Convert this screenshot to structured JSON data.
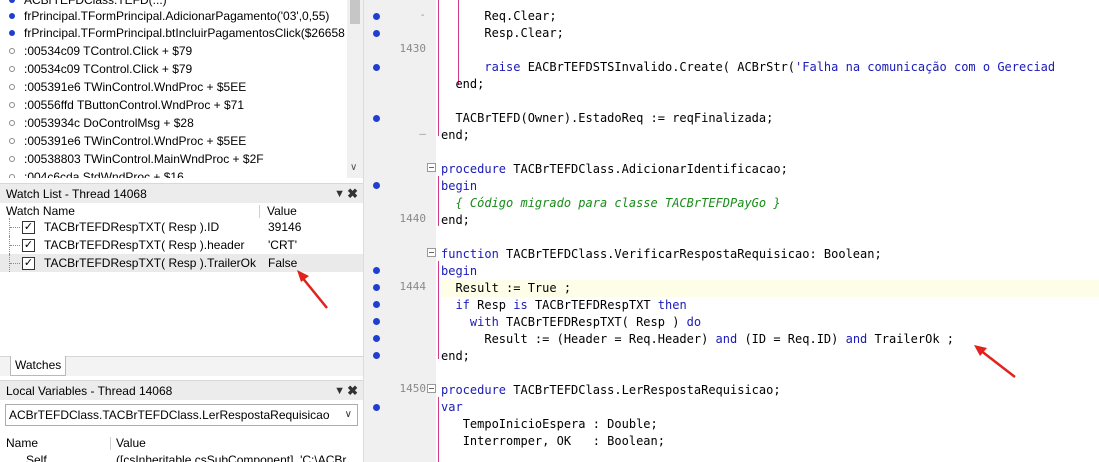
{
  "call_stack": {
    "rows": [
      {
        "dot": "blue",
        "text": "ACBrTEFDClass.TEFD(...)"
      },
      {
        "dot": "blue",
        "text": "frPrincipal.TFormPrincipal.AdicionarPagamento('03',0,55)"
      },
      {
        "dot": "blue",
        "text": "frPrincipal.TFormPrincipal.btIncluirPagamentosClick($26658"
      },
      {
        "dot": "grey",
        "text": ":00534c09 TControl.Click + $79"
      },
      {
        "dot": "grey",
        "text": ":00534c09 TControl.Click + $79"
      },
      {
        "dot": "grey",
        "text": ":005391e6 TWinControl.WndProc + $5EE"
      },
      {
        "dot": "grey",
        "text": ":00556ffd TButtonControl.WndProc + $71"
      },
      {
        "dot": "grey",
        "text": ":0053934c DoControlMsg + $28"
      },
      {
        "dot": "grey",
        "text": ":005391e6 TWinControl.WndProc + $5EE"
      },
      {
        "dot": "grey",
        "text": ":00538803 TWinControl.MainWndProc + $2F"
      },
      {
        "dot": "grey",
        "text": ":004c6cda StdWndProc + $16"
      }
    ]
  },
  "watch_list": {
    "title": "Watch List - Thread 14068",
    "pin_icon": "pin-icon",
    "close_icon": "close-icon",
    "col_name": "Watch Name",
    "col_value": "Value",
    "rows": [
      {
        "name": "TACBrTEFDRespTXT( Resp ).ID",
        "value": "39146",
        "checked": true
      },
      {
        "name": "TACBrTEFDRespTXT( Resp ).header",
        "value": "'CRT'",
        "checked": true
      },
      {
        "name": "TACBrTEFDRespTXT( Resp ).TrailerOk",
        "value": "False",
        "checked": true
      }
    ],
    "tab_label": "Watches"
  },
  "local_variables": {
    "title": "Local Variables - Thread 14068",
    "selected_scope": "ACBrTEFDClass.TACBrTEFDClass.LerRespostaRequisicao",
    "col_name": "Name",
    "col_value": "Value",
    "partial_row_name": "Self",
    "partial_row_value": "([csInheritable,csSubComponent], 'C:\\ACBr"
  },
  "editor": {
    "line_numbers": [
      "1430",
      "1440",
      "1444",
      "1450"
    ],
    "code": {
      "l1": "Req.Clear;",
      "l2": "Resp.Clear;",
      "l3_kw": "raise",
      "l3_a": " EACBrTEFDSTSInvalido.Create( ACBrStr(",
      "l3_str": "'Falha na comunicação com o Gereciad",
      "l4": "end;",
      "l5": "TACBrTEFD(Owner).EstadoReq := reqFinalizada;",
      "l6": "end;",
      "l7_kw": "procedure",
      "l7_a": " TACBrTEFDClass.AdicionarIdentificacao;",
      "l8": "begin",
      "l9": "{ Código migrado para classe TACBrTEFDPayGo }",
      "l10": "end;",
      "l11_kw": "function",
      "l11_a": " TACBrTEFDClass.VerificarRespostaRequisicao: Boolean;",
      "l12": "begin",
      "l13": "Result := True ;",
      "l14_kw1": "if",
      "l14_a": " Resp ",
      "l14_kw2": "is",
      "l14_b": " TACBrTEFDRespTXT ",
      "l14_kw3": "then",
      "l15_kw": "with",
      "l15_a": " TACBrTEFDRespTXT( Resp ) ",
      "l15_kw2": "do",
      "l16_a": "Result := (Header = Req.Header) ",
      "l16_kw1": "and",
      "l16_b": " (ID = Req.ID) ",
      "l16_kw2": "and",
      "l16_c": " TrailerOk ;",
      "l17": "end;",
      "l18_kw": "procedure",
      "l18_a": " TACBrTEFDClass.LerRespostaRequisicao;",
      "l19": "var",
      "l20": "TempoInicioEspera : Double;",
      "l21": "Interromper, OK   : Boolean;"
    }
  },
  "colors": {
    "breakpoint": "#1f3fd1",
    "keyword": "#1a1ab8",
    "comment": "#1a8c1a",
    "block_marker": "#d23a8c",
    "annotation_arrow": "#e0231c"
  }
}
